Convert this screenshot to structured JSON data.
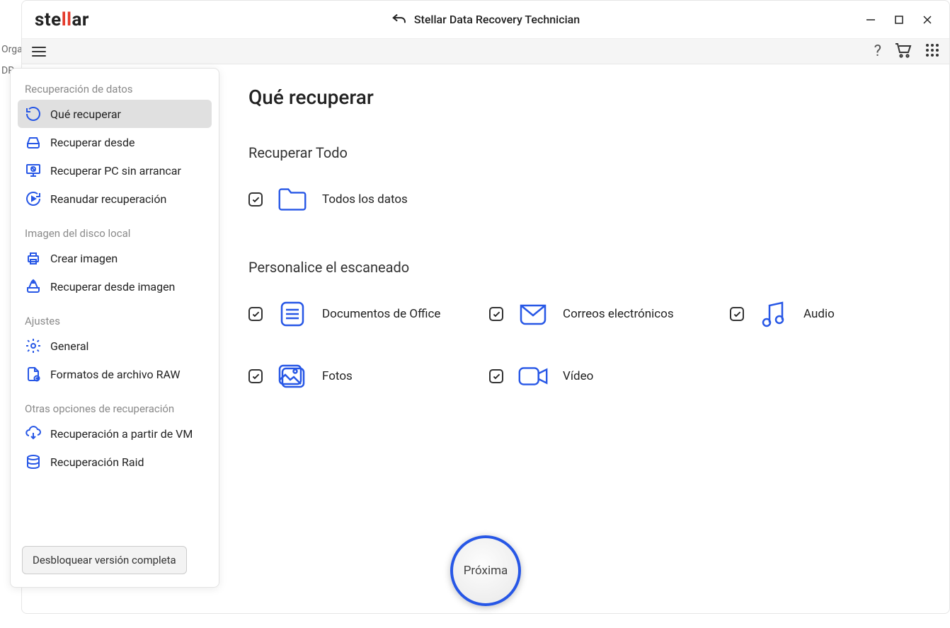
{
  "bg": {
    "organ": "Organ",
    "dr": "DR"
  },
  "titlebar": {
    "logo_pre": "ste",
    "logo_mid": "ll",
    "logo_post": "ar",
    "app_title": "Stellar Data Recovery Technician"
  },
  "sidebar": {
    "section1_title": "Recuperación de datos",
    "section1_items": [
      {
        "label": "Qué recuperar",
        "icon": "restore",
        "active": true
      },
      {
        "label": "Recuperar desde",
        "icon": "drive",
        "active": false
      },
      {
        "label": "Recuperar PC sin arrancar",
        "icon": "monitor",
        "active": false
      },
      {
        "label": "Reanudar recuperación",
        "icon": "resume",
        "active": false
      }
    ],
    "section2_title": "Imagen del disco local",
    "section2_items": [
      {
        "label": "Crear imagen",
        "icon": "print"
      },
      {
        "label": "Recuperar desde imagen",
        "icon": "driveimg"
      }
    ],
    "section3_title": "Ajustes",
    "section3_items": [
      {
        "label": "General",
        "icon": "gear"
      },
      {
        "label": "Formatos de archivo RAW",
        "icon": "file"
      }
    ],
    "section4_title": "Otras opciones de recuperación",
    "section4_items": [
      {
        "label": "Recuperación a partir de VM",
        "icon": "cloud"
      },
      {
        "label": "Recuperación Raid",
        "icon": "raid"
      }
    ],
    "unlock_label": "Desbloquear versión completa"
  },
  "content": {
    "page_title": "Qué recuperar",
    "section_all_title": "Recuperar Todo",
    "all_data_label": "Todos los datos",
    "section_custom_title": "Personalice el escaneado",
    "opts": {
      "office": "Documentos de Office",
      "emails": "Correos electrónicos",
      "audio": "Audio",
      "photos": "Fotos",
      "video": "Vídeo"
    },
    "next_label": "Próxima"
  }
}
